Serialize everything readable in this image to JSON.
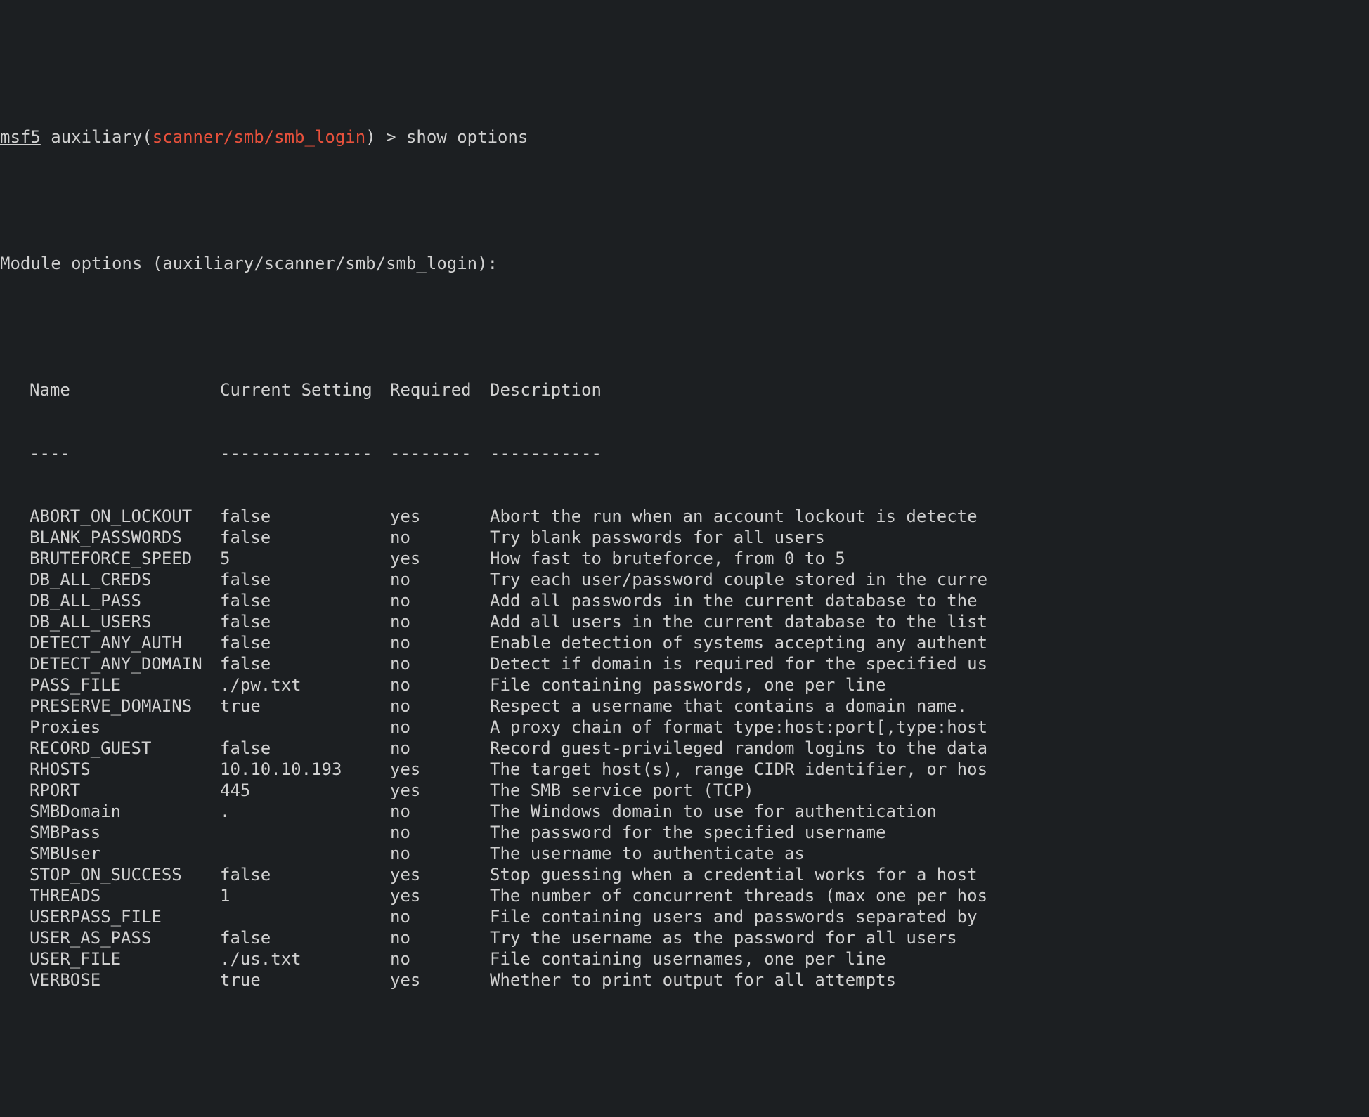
{
  "prompt": {
    "prefix": "msf5",
    "context_prefix": " auxiliary(",
    "module_path": "scanner/smb/smb_login",
    "context_suffix": ") > ",
    "command": "show options"
  },
  "module_header": "Module options (auxiliary/scanner/smb/smb_login):",
  "headers": {
    "name": "Name",
    "setting": "Current Setting",
    "required": "Required",
    "description": "Description"
  },
  "rules": {
    "name": "----",
    "setting": "---------------",
    "required": "--------",
    "description": "-----------"
  },
  "options": [
    {
      "name": "ABORT_ON_LOCKOUT",
      "setting": "false",
      "required": "yes",
      "description": "Abort the run when an account lockout is detecte"
    },
    {
      "name": "BLANK_PASSWORDS",
      "setting": "false",
      "required": "no",
      "description": "Try blank passwords for all users"
    },
    {
      "name": "BRUTEFORCE_SPEED",
      "setting": "5",
      "required": "yes",
      "description": "How fast to bruteforce, from 0 to 5"
    },
    {
      "name": "DB_ALL_CREDS",
      "setting": "false",
      "required": "no",
      "description": "Try each user/password couple stored in the curre"
    },
    {
      "name": "DB_ALL_PASS",
      "setting": "false",
      "required": "no",
      "description": "Add all passwords in the current database to the"
    },
    {
      "name": "DB_ALL_USERS",
      "setting": "false",
      "required": "no",
      "description": "Add all users in the current database to the list"
    },
    {
      "name": "DETECT_ANY_AUTH",
      "setting": "false",
      "required": "no",
      "description": "Enable detection of systems accepting any authent"
    },
    {
      "name": "DETECT_ANY_DOMAIN",
      "setting": "false",
      "required": "no",
      "description": "Detect if domain is required for the specified us"
    },
    {
      "name": "PASS_FILE",
      "setting": "./pw.txt",
      "required": "no",
      "description": "File containing passwords, one per line"
    },
    {
      "name": "PRESERVE_DOMAINS",
      "setting": "true",
      "required": "no",
      "description": "Respect a username that contains a domain name."
    },
    {
      "name": "Proxies",
      "setting": "",
      "required": "no",
      "description": "A proxy chain of format type:host:port[,type:host"
    },
    {
      "name": "RECORD_GUEST",
      "setting": "false",
      "required": "no",
      "description": "Record guest-privileged random logins to the data"
    },
    {
      "name": "RHOSTS",
      "setting": "10.10.10.193",
      "required": "yes",
      "description": "The target host(s), range CIDR identifier, or hos"
    },
    {
      "name": "RPORT",
      "setting": "445",
      "required": "yes",
      "description": "The SMB service port (TCP)"
    },
    {
      "name": "SMBDomain",
      "setting": ".",
      "required": "no",
      "description": "The Windows domain to use for authentication"
    },
    {
      "name": "SMBPass",
      "setting": "",
      "required": "no",
      "description": "The password for the specified username"
    },
    {
      "name": "SMBUser",
      "setting": "",
      "required": "no",
      "description": "The username to authenticate as"
    },
    {
      "name": "STOP_ON_SUCCESS",
      "setting": "false",
      "required": "yes",
      "description": "Stop guessing when a credential works for a host"
    },
    {
      "name": "THREADS",
      "setting": "1",
      "required": "yes",
      "description": "The number of concurrent threads (max one per hos"
    },
    {
      "name": "USERPASS_FILE",
      "setting": "",
      "required": "no",
      "description": "File containing users and passwords separated by"
    },
    {
      "name": "USER_AS_PASS",
      "setting": "false",
      "required": "no",
      "description": "Try the username as the password for all users"
    },
    {
      "name": "USER_FILE",
      "setting": "./us.txt",
      "required": "no",
      "description": "File containing usernames, one per line"
    },
    {
      "name": "VERBOSE",
      "setting": "true",
      "required": "yes",
      "description": "Whether to print output for all attempts"
    }
  ]
}
